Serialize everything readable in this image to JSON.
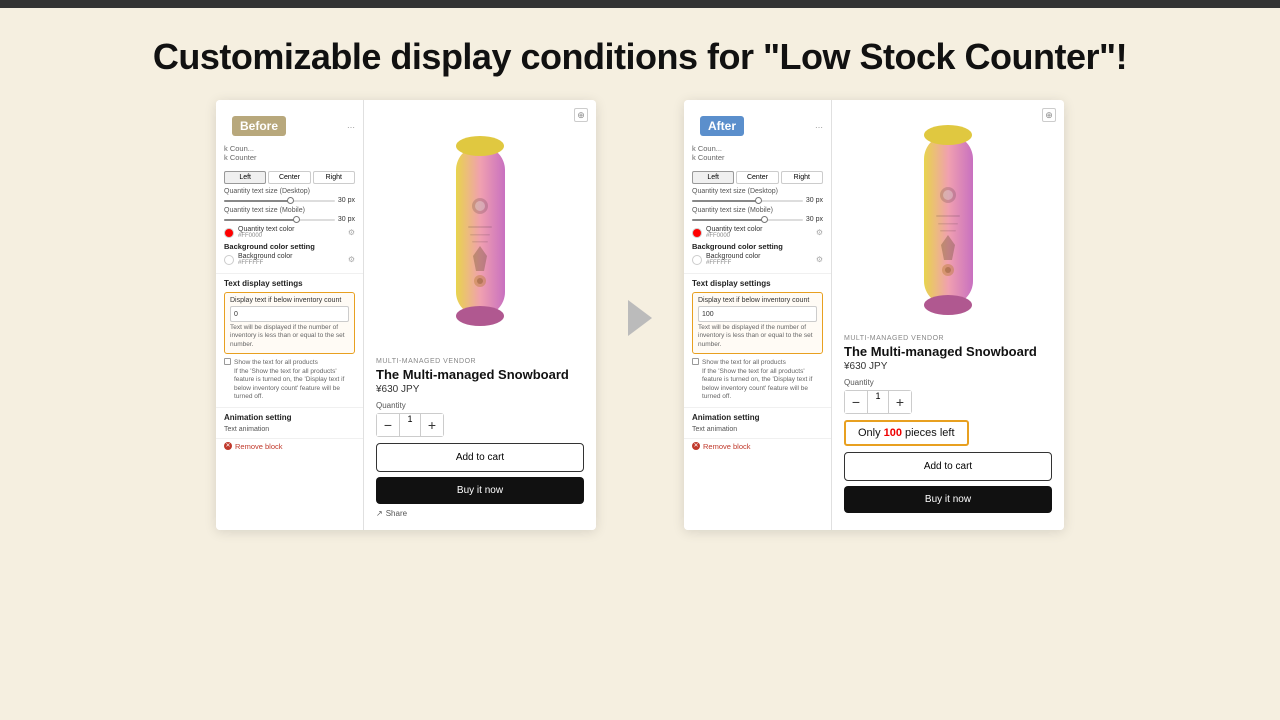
{
  "topBar": {
    "color": "#333"
  },
  "title": "Customizable display conditions for \"Low Stock Counter\"!",
  "before": {
    "badge": "Before",
    "panelHeader": {
      "title": "k Coun...",
      "subtitle": "k Counter"
    },
    "alignButtons": [
      "Left",
      "Center",
      "Right"
    ],
    "activeAlign": "Left",
    "quantityTextDesktop": {
      "label": "Quantity text size (Desktop)",
      "value": "30",
      "unit": "px",
      "fillPercent": 60
    },
    "quantityTextMobile": {
      "label": "Quantity text size (Mobile)",
      "value": "30",
      "unit": "px",
      "fillPercent": 65
    },
    "quantityTextColor": {
      "label": "Quantity text color",
      "hex": "#FF0000",
      "color": "#FF0000"
    },
    "bgColorSetting": {
      "label": "Background color setting",
      "subLabel": "Background color",
      "hex": "#FFFFFF",
      "color": "#FFFFFF"
    },
    "textDisplaySettings": {
      "title": "Text display settings",
      "displayLabel": "Display text if below inventory count",
      "inputValue": "0",
      "helperText": "Text will be displayed if the number of inventory is less than or equal to the set number.",
      "checkboxLabel": "Show the text for all products",
      "checkboxHelperText": "If the 'Show the text for all products' feature is turned on, the 'Display text if below inventory count' feature will be turned off."
    },
    "animationSetting": {
      "title": "Animation setting",
      "label": "Text animation"
    },
    "removeBlock": "Remove block",
    "product": {
      "zoomIcon": "⊕",
      "vendor": "MULTI-MANAGED VENDOR",
      "name": "The Multi-managed Snowboard",
      "price": "¥630 JPY",
      "quantityLabel": "Quantity",
      "quantityValue": "1",
      "addToCart": "Add to cart",
      "buyNow": "Buy it now",
      "shareLabel": "Share"
    }
  },
  "after": {
    "badge": "After",
    "panelHeader": {
      "title": "k Coun...",
      "subtitle": "k Counter"
    },
    "alignButtons": [
      "Left",
      "Center",
      "Right"
    ],
    "activeAlign": "Left",
    "quantityTextDesktop": {
      "label": "Quantity text size (Desktop)",
      "value": "30",
      "unit": "px",
      "fillPercent": 60
    },
    "quantityTextMobile": {
      "label": "Quantity text size (Mobile)",
      "value": "30",
      "unit": "px",
      "fillPercent": 65
    },
    "quantityTextColor": {
      "label": "Quantity text color",
      "hex": "#FF0000",
      "color": "#FF0000"
    },
    "bgColorSetting": {
      "label": "Background color setting",
      "subLabel": "Background color",
      "hex": "#FFFFFF",
      "color": "#FFFFFF"
    },
    "textDisplaySettings": {
      "title": "Text display settings",
      "displayLabel": "Display text if below inventory count",
      "inputValue": "100",
      "helperText": "Text will be displayed if the number of inventory is less than or equal to the set number.",
      "checkboxLabel": "Show the text for all products",
      "checkboxHelperText": "If the 'Show the text for all products' feature is turned on, the 'Display text if below inventory count' feature will be turned off."
    },
    "animationSetting": {
      "title": "Animation setting",
      "label": "Text animation"
    },
    "removeBlock": "Remove block",
    "product": {
      "vendor": "MULTI-MANAGED VENDOR",
      "name": "The Multi-managed Snowboard",
      "price": "¥630 JPY",
      "quantityLabel": "Quantity",
      "quantityValue": "1",
      "lowStock": {
        "prefix": "Only",
        "number": "100",
        "suffix": "pieces left"
      },
      "addToCart": "Add to cart",
      "buyNow": "Buy it now"
    }
  },
  "arrow": "▶"
}
